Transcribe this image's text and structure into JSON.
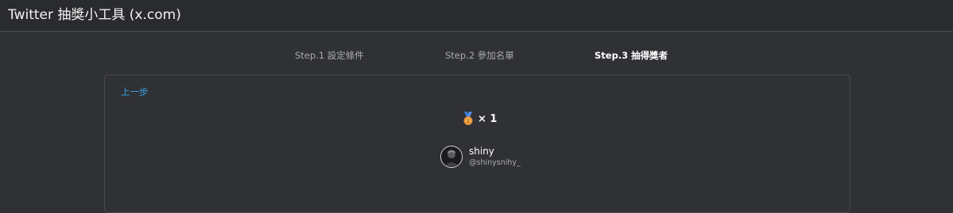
{
  "app": {
    "title": "Twitter 抽獎小工具 (x.com)"
  },
  "steps": [
    {
      "label": "Step.1 設定條件",
      "active": false
    },
    {
      "label": "Step.2 參加名單",
      "active": false
    },
    {
      "label": "Step.3 抽得獎者",
      "active": true
    }
  ],
  "card": {
    "back_label": "上一步",
    "prize": {
      "icon": "medal-icon",
      "count_label": "× 1"
    },
    "winner": {
      "name": "shiny",
      "handle": "@shinysnihy_",
      "avatar_icon": "avatar"
    }
  },
  "colors": {
    "background": "#303135",
    "header": "#2a2b2e",
    "border": "#4a4b50",
    "link": "#3aa0e8",
    "muted_text": "#a9abb0"
  }
}
